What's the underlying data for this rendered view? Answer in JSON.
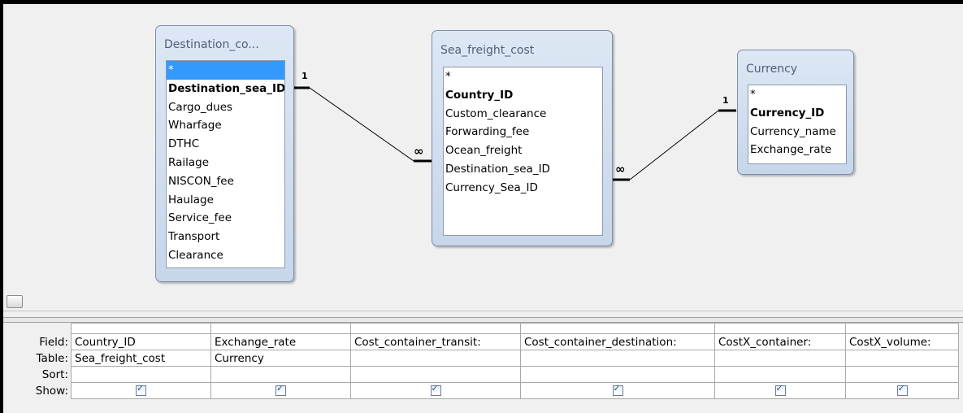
{
  "tables": {
    "destination": {
      "title": "Destination_co...",
      "fields": [
        "*",
        "Destination_sea_ID",
        "Cargo_dues",
        "Wharfage",
        "DTHC",
        "Railage",
        "NISCON_fee",
        "Haulage",
        "Service_fee",
        "Transport",
        "Clearance"
      ]
    },
    "sea_freight": {
      "title": "Sea_freight_cost",
      "fields": [
        "*",
        "Country_ID",
        "Custom_clearance",
        "Forwarding_fee",
        "Ocean_freight",
        "Destination_sea_ID",
        "Currency_Sea_ID"
      ]
    },
    "currency": {
      "title": "Currency",
      "fields": [
        "*",
        "Currency_ID",
        "Currency_name",
        "Exchange_rate"
      ]
    }
  },
  "relationships": {
    "one": "1",
    "many": "∞"
  },
  "grid": {
    "row_labels": {
      "field": "Field:",
      "table": "Table:",
      "sort": "Sort:",
      "show": "Show:"
    },
    "columns": [
      {
        "field": "Country_ID",
        "table": "Sea_freight_cost",
        "sort": "",
        "show": true
      },
      {
        "field": "Exchange_rate",
        "table": "Currency",
        "sort": "",
        "show": true
      },
      {
        "field": "Cost_container_transit:",
        "table": "",
        "sort": "",
        "show": true
      },
      {
        "field": "Cost_container_destination:",
        "table": "",
        "sort": "",
        "show": true
      },
      {
        "field": "CostX_container:",
        "table": "",
        "sort": "",
        "show": true
      },
      {
        "field": "CostX_volume:",
        "table": "",
        "sort": "",
        "show": true
      }
    ]
  }
}
